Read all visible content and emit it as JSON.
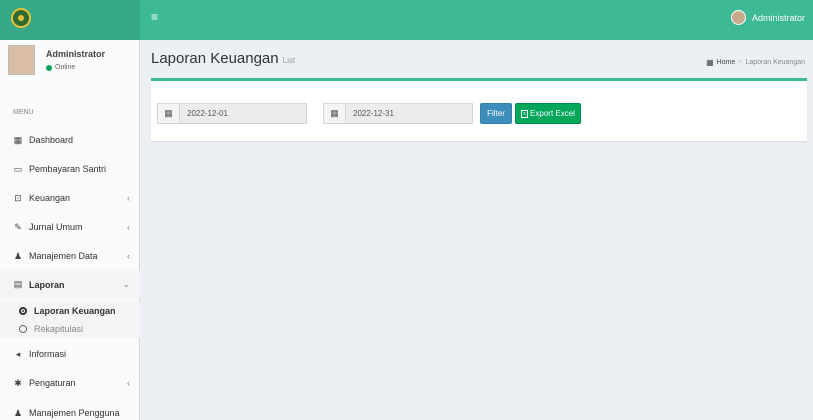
{
  "header": {
    "menu_icon": "hamburger-icon",
    "user_name": "Administrator"
  },
  "sidebar": {
    "user": {
      "name": "Administrator",
      "status": "Online"
    },
    "menu_header": "MENU",
    "items": [
      {
        "label": "Dashboard",
        "icon": "grid-icon"
      },
      {
        "label": "Pembayaran Santri",
        "icon": "credit-card-icon"
      },
      {
        "label": "Keuangan",
        "icon": "money-icon"
      },
      {
        "label": "Jurnal Umum",
        "icon": "edit-icon"
      },
      {
        "label": "Manajemen Data",
        "icon": "users-icon"
      },
      {
        "label": "Laporan",
        "icon": "file-icon"
      },
      {
        "label": "Informasi",
        "icon": "bullhorn-icon"
      },
      {
        "label": "Pengaturan",
        "icon": "gear-icon"
      },
      {
        "label": "Manajemen Pengguna",
        "icon": "user-icon"
      }
    ],
    "laporan_sub": [
      {
        "label": "Laporan Keuangan",
        "active": true
      },
      {
        "label": "Rekapitulasi",
        "active": false
      }
    ]
  },
  "content": {
    "title": "Laporan Keuangan",
    "subtitle": "List",
    "breadcrumb": {
      "home": "Home",
      "current": "Laporan Keuangan"
    },
    "filter": {
      "start_date": "2022-12-01",
      "end_date": "2022-12-31",
      "filter_label": "Filter",
      "export_label": "Export Excel"
    }
  },
  "colors": {
    "accent": "#3dba95",
    "filter_btn": "#3c8dbc",
    "export_btn": "#00a65a"
  }
}
